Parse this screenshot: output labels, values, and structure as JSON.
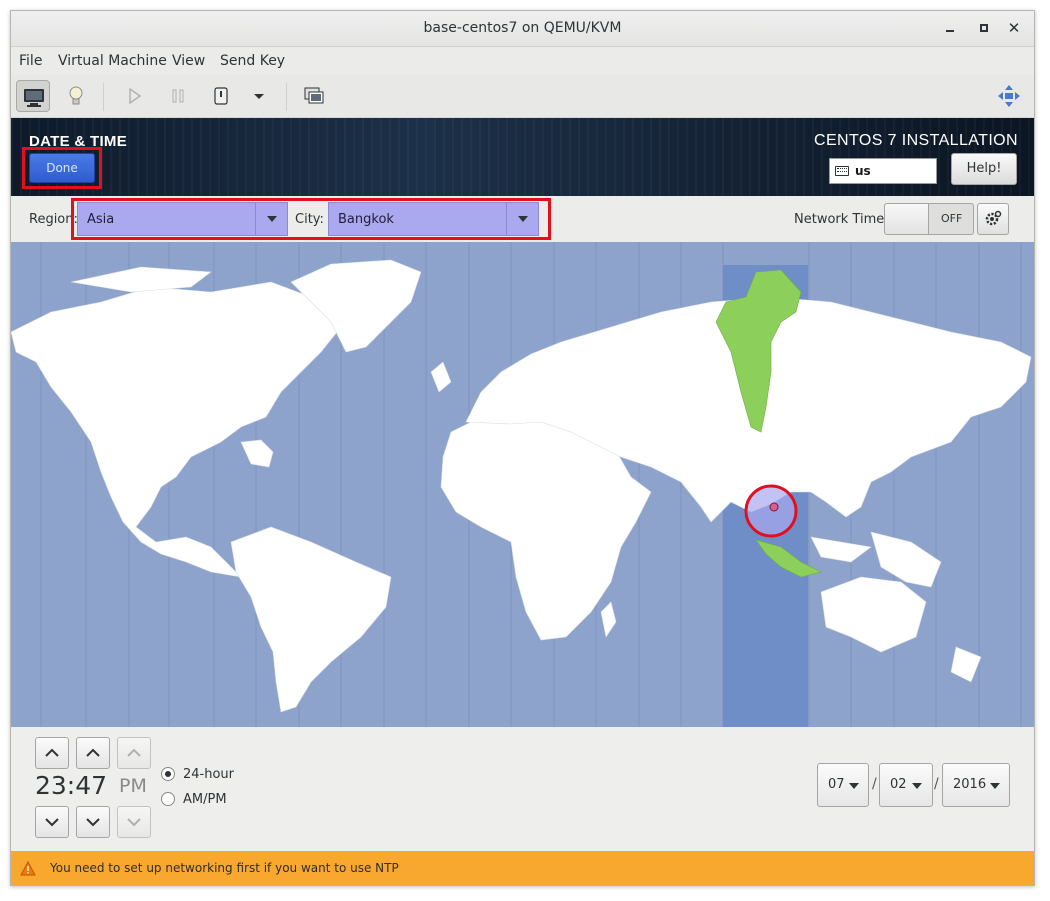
{
  "window": {
    "title": "base-centos7 on QEMU/KVM",
    "controls": [
      "minimize-icon",
      "maximize-icon",
      "close-icon"
    ]
  },
  "menu": {
    "items": [
      "File",
      "Virtual Machine",
      "View",
      "Send Key"
    ]
  },
  "toolbar": {
    "buttons": [
      "console-icon",
      "details-lightbulb-icon",
      "run-icon",
      "pause-icon",
      "shutdown-icon",
      "shutdown-menu-icon",
      "snapshots-icon",
      "fullscreen-icon"
    ]
  },
  "installer": {
    "spoke_title": "DATE & TIME",
    "done_label": "Done",
    "product_title": "CENTOS 7 INSTALLATION",
    "keyboard_layout": "us",
    "help_label": "Help!"
  },
  "location": {
    "region_label": "Region:",
    "region_value": "Asia",
    "city_label": "City:",
    "city_value": "Bangkok",
    "network_time_label": "Network Time",
    "network_time_state": "OFF"
  },
  "clock": {
    "time": "23:47",
    "ampm": "PM",
    "format_24_label": "24-hour",
    "format_ampm_label": "AM/PM",
    "selected_format": "24-hour",
    "month": "07",
    "day": "02",
    "year": "2016"
  },
  "warning": {
    "message": "You need to set up networking first if you want to use NTP"
  },
  "colors": {
    "ocean": "#8ea3cb",
    "land": "#ffffff",
    "timezone_highlight": "#6f8ec8",
    "selected_zone": "#8ccf5a",
    "combo": "#aaa8ef",
    "done_button": "#2f5ccf",
    "warning_bar": "#f8a72f",
    "highlight_box": "#e0101e"
  }
}
